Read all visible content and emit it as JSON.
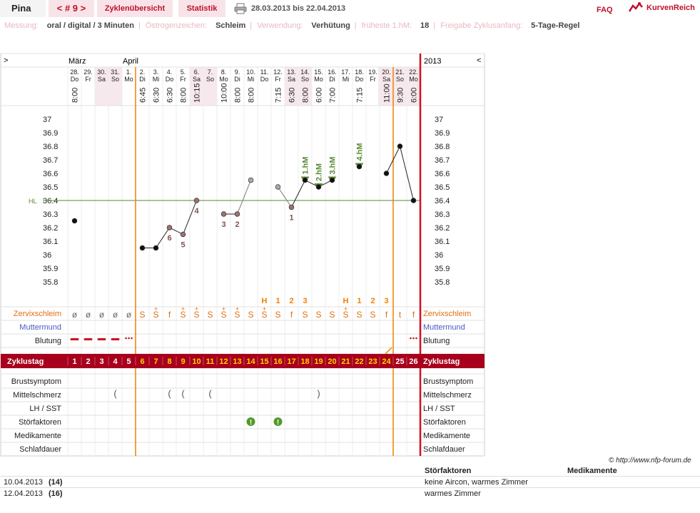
{
  "topbar": {
    "name": "Pina",
    "cycle": "< # 9 >",
    "overview": "Zyklenübersicht",
    "stats": "Statistik",
    "daterange": "28.03.2013 bis 22.04.2013",
    "faq": "FAQ",
    "brand": "KurvenReich"
  },
  "info": [
    {
      "label": "Messung:",
      "value": "oral / digital / 3 Minuten"
    },
    {
      "label": "Östrogenzeichen:",
      "value": "Schleim"
    },
    {
      "label": "Verwendung:",
      "value": "Verhütung"
    },
    {
      "label": "früheste 1.hM:",
      "value": "18"
    },
    {
      "label": "Freigabe Zyklusanfang:",
      "value": "5-Tage-Regel"
    }
  ],
  "chart_data": {
    "type": "line",
    "nav_left": ">",
    "nav_right": "<",
    "year": "2013",
    "months": [
      {
        "label": "März",
        "day_index": 0
      },
      {
        "label": "April",
        "day_index": 4
      }
    ],
    "days": [
      {
        "date": "28.",
        "wd": "Do",
        "time": "8:00",
        "temp": 36.25,
        "mucus": "ø",
        "bleed": "dash",
        "cd": "1"
      },
      {
        "date": "29.",
        "wd": "Fr",
        "time": "",
        "temp": null,
        "mucus": "ø",
        "bleed": "dash",
        "cd": "2"
      },
      {
        "date": "30.",
        "wd": "Sa",
        "time": "",
        "temp": null,
        "mucus": "ø",
        "bleed": "dash",
        "cd": "3"
      },
      {
        "date": "31.",
        "wd": "So",
        "time": "",
        "temp": null,
        "mucus": "ø",
        "bleed": "dash",
        "cd": "4"
      },
      {
        "date": "1.",
        "wd": "Mo",
        "time": "",
        "temp": null,
        "mucus": "ø",
        "bleed": "dots",
        "cd": "5"
      },
      {
        "date": "2.",
        "wd": "Di",
        "time": "6:45",
        "temp": 36.05,
        "mucus": "S",
        "bleed": "",
        "cd": "6"
      },
      {
        "date": "3.",
        "wd": "Mi",
        "time": "6:30",
        "temp": 36.05,
        "mucus": "S+",
        "bleed": "",
        "cd": "7"
      },
      {
        "date": "4.",
        "wd": "Do",
        "time": "6:30",
        "temp": 36.2,
        "mucus": "f",
        "bleed": "",
        "cd": "8",
        "num": "6"
      },
      {
        "date": "5.",
        "wd": "Fr",
        "time": "8:00",
        "temp": 36.15,
        "mucus": "S+",
        "bleed": "",
        "cd": "9",
        "num": "5"
      },
      {
        "date": "6.",
        "wd": "Sa",
        "time": "10:15",
        "temp": 36.4,
        "mucus": "S+",
        "bleed": "",
        "cd": "10",
        "num": "4"
      },
      {
        "date": "7.",
        "wd": "So",
        "time": "",
        "temp": null,
        "mucus": "S",
        "bleed": "",
        "cd": "11"
      },
      {
        "date": "8.",
        "wd": "Mo",
        "time": "10:00",
        "temp": 36.3,
        "mucus": "S+",
        "bleed": "",
        "cd": "12",
        "num": "3"
      },
      {
        "date": "9.",
        "wd": "Di",
        "time": "8:00",
        "temp": 36.3,
        "mucus": "S+",
        "bleed": "",
        "cd": "13",
        "num": "2"
      },
      {
        "date": "10.",
        "wd": "Mi",
        "time": "8:00",
        "temp": 36.55,
        "mucus": "S",
        "bleed": "",
        "cd": "14"
      },
      {
        "date": "11.",
        "wd": "Do",
        "time": "",
        "temp": null,
        "mucus": "S+",
        "bleed": "",
        "cd": "15",
        "h": "H"
      },
      {
        "date": "12.",
        "wd": "Fr",
        "time": "7:15",
        "temp": 36.5,
        "mucus": "S",
        "bleed": "",
        "cd": "16",
        "h": "1"
      },
      {
        "date": "13.",
        "wd": "Sa",
        "time": "6:30",
        "temp": 36.35,
        "mucus": "f",
        "bleed": "",
        "cd": "17",
        "num": "1",
        "h": "2"
      },
      {
        "date": "14.",
        "wd": "So",
        "time": "8:00",
        "temp": 36.55,
        "mucus": "S",
        "bleed": "",
        "cd": "18",
        "hm": "1.hM",
        "h": "3"
      },
      {
        "date": "15.",
        "wd": "Mo",
        "time": "6:00",
        "temp": 36.5,
        "mucus": "S",
        "bleed": "",
        "cd": "19",
        "hm": "2.hM"
      },
      {
        "date": "16.",
        "wd": "Di",
        "time": "7:00",
        "temp": 36.55,
        "mucus": "S",
        "bleed": "",
        "cd": "20",
        "hm": "3.hM"
      },
      {
        "date": "17.",
        "wd": "Mi",
        "time": "",
        "temp": null,
        "mucus": "S+",
        "bleed": "",
        "cd": "21",
        "h": "H"
      },
      {
        "date": "18.",
        "wd": "Do",
        "time": "7:15",
        "temp": 36.65,
        "mucus": "S",
        "bleed": "",
        "cd": "22",
        "hm": "4.hM",
        "h": "1"
      },
      {
        "date": "19.",
        "wd": "Fr",
        "time": "",
        "temp": null,
        "mucus": "S",
        "bleed": "",
        "cd": "23",
        "h": "2"
      },
      {
        "date": "20.",
        "wd": "Sa",
        "time": "11:00",
        "temp": 36.6,
        "mucus": "f",
        "bleed": "",
        "cd": "24",
        "h": "3"
      },
      {
        "date": "21.",
        "wd": "So",
        "time": "9:30",
        "temp": 36.8,
        "mucus": "t",
        "bleed": "",
        "cd": "25"
      },
      {
        "date": "22.",
        "wd": "Mo",
        "time": "6:00",
        "temp": 36.4,
        "mucus": "f",
        "bleed": "dots",
        "cd": "26"
      }
    ],
    "y_ticks": [
      37,
      36.9,
      36.8,
      36.7,
      36.6,
      36.5,
      36.4,
      36.3,
      36.2,
      36.1,
      36,
      35.9,
      35.8
    ],
    "ylim": [
      35.8,
      37
    ],
    "hl_label": "HL",
    "hl_value": 36.4,
    "sections": {
      "zervix": "Zervixschleim",
      "muttermund": "Muttermund",
      "blutung": "Blutung",
      "zyklustag": "Zyklustag",
      "brust": "Brustsymptom",
      "mittel": "Mittelschmerz",
      "lh": "LH / SST",
      "stoer": "Störfaktoren",
      "medi": "Medikamente",
      "schlaf": "Schlafdauer"
    },
    "mittelschmerz": [
      {
        "day_index": 3,
        "sym": "("
      },
      {
        "day_index": 7,
        "sym": "("
      },
      {
        "day_index": 8,
        "sym": "("
      },
      {
        "day_index": 10,
        "sym": "("
      },
      {
        "day_index": 18,
        "sym": ")"
      }
    ],
    "stoer_days": [
      13,
      15
    ],
    "colors": {
      "accent": "#a8001c",
      "orange": "#f08000",
      "green": "#5a8a30",
      "mucus": "#e07010",
      "blue": "#4a58c8"
    }
  },
  "footer": {
    "credit": "© http://www.nfp-forum.de",
    "col_stoer": "Störfaktoren",
    "col_medi": "Medikamente",
    "entries": [
      {
        "date": "10.04.2013",
        "cd": "(14)",
        "text": "keine Aircon, warmes Zimmer"
      },
      {
        "date": "12.04.2013",
        "cd": "(16)",
        "text": "warmes Zimmer"
      }
    ]
  }
}
